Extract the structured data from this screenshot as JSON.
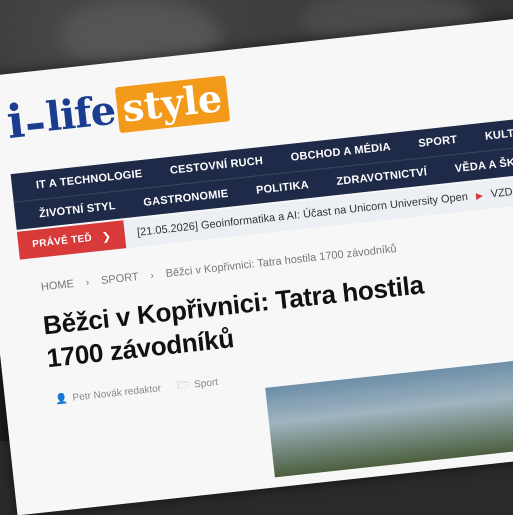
{
  "logo": {
    "prefix": "i",
    "part1": "life",
    "part2": "style"
  },
  "nav": {
    "row1": [
      "IT A TECHNOLOGIE",
      "CESTOVNÍ RUCH",
      "OBCHOD A MÉDIA",
      "SPORT",
      "KULTURA"
    ],
    "row2": [
      "ŽIVOTNÍ STYL",
      "GASTRONOMIE",
      "POLITIKA",
      "ZDRAVOTNICTVÍ",
      "VĚDA A ŠKOLS"
    ]
  },
  "ticker": {
    "label": "PRÁVĚ TEĎ",
    "headline": "[21.05.2026] Geoinformatika a AI: Účast na Unicorn University Open",
    "next": "VZDĚLÁVÁNÍ"
  },
  "breadcrumb": {
    "home": "HOME",
    "section": "SPORT",
    "current": "Běžci v Kopřivnici: Tatra hostila 1700 závodníků"
  },
  "article": {
    "title": "Běžci v Kopřivnici: Tatra hostila 1700 závodníků",
    "author": "Petr Novák redaktor",
    "category": "Sport"
  },
  "icons": {
    "ticker_arrow": "chevron-right-icon",
    "author": "user-icon",
    "category": "folder-icon"
  },
  "colors": {
    "brand_blue": "#1a3d8f",
    "brand_orange": "#f39a1a",
    "nav_bg": "#1e2a47",
    "ticker_red": "#d83a3a"
  }
}
